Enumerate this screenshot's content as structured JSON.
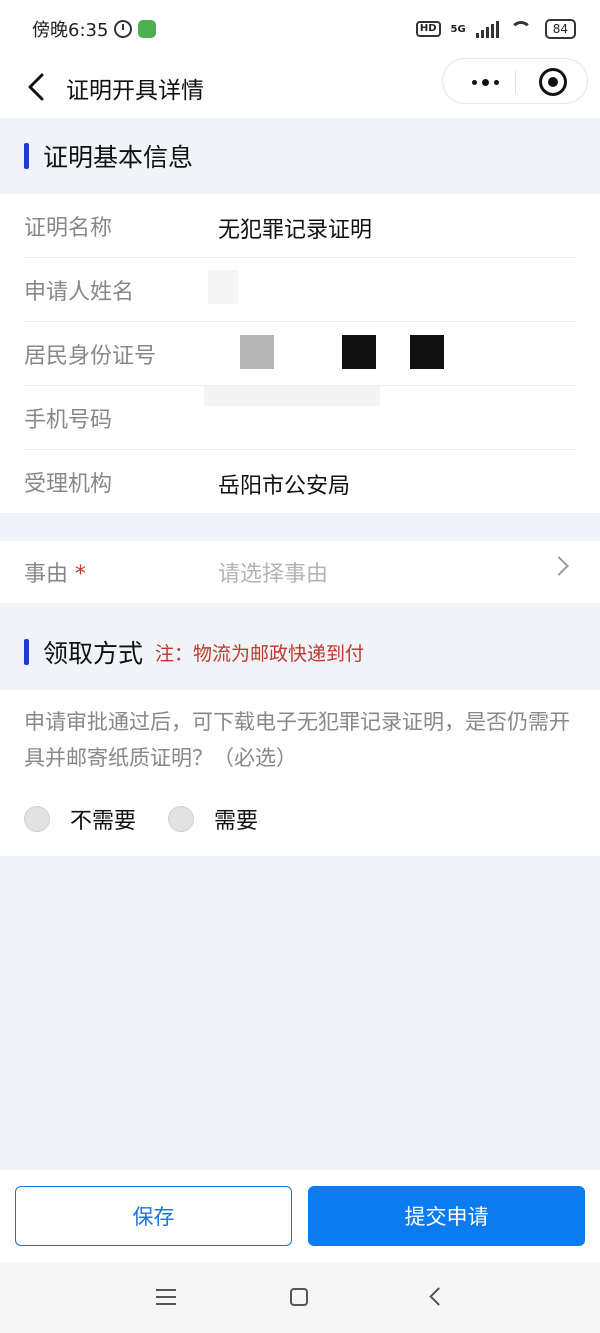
{
  "status_bar": {
    "time": "傍晚6:35",
    "network": "5G",
    "hd": "HD",
    "battery": "84",
    "icons": [
      "alarm-icon",
      "app-notification-icon",
      "hd-icon",
      "signal-icon",
      "wifi-icon",
      "battery-icon"
    ]
  },
  "navbar": {
    "title": "证明开具详情",
    "icons": [
      "back-icon",
      "more-icon",
      "target-icon"
    ]
  },
  "basic_info": {
    "title": "证明基本信息",
    "fields": [
      {
        "label": "证明名称",
        "value": "无犯罪记录证明"
      },
      {
        "label": "申请人姓名",
        "value": ""
      },
      {
        "label": "居民身份证号",
        "value": ""
      },
      {
        "label": "手机号码",
        "value": ""
      },
      {
        "label": "受理机构",
        "value": "岳阳市公安局"
      }
    ]
  },
  "reason": {
    "label": "事由",
    "required_mark": "*",
    "placeholder": "请选择事由"
  },
  "pickup": {
    "title": "领取方式",
    "note": "注：物流为邮政快递到付",
    "question": "申请审批通过后，可下载电子无犯罪记录证明，是否仍需开具并邮寄纸质证明？（必选）",
    "options": [
      "不需要",
      "需要"
    ]
  },
  "actions": {
    "save": "保存",
    "submit": "提交申请"
  },
  "colors": {
    "accent": "#0a7cf0",
    "section_marker": "#1e3fc8",
    "note_red": "#c0392b",
    "background": "#f0f3f8"
  }
}
